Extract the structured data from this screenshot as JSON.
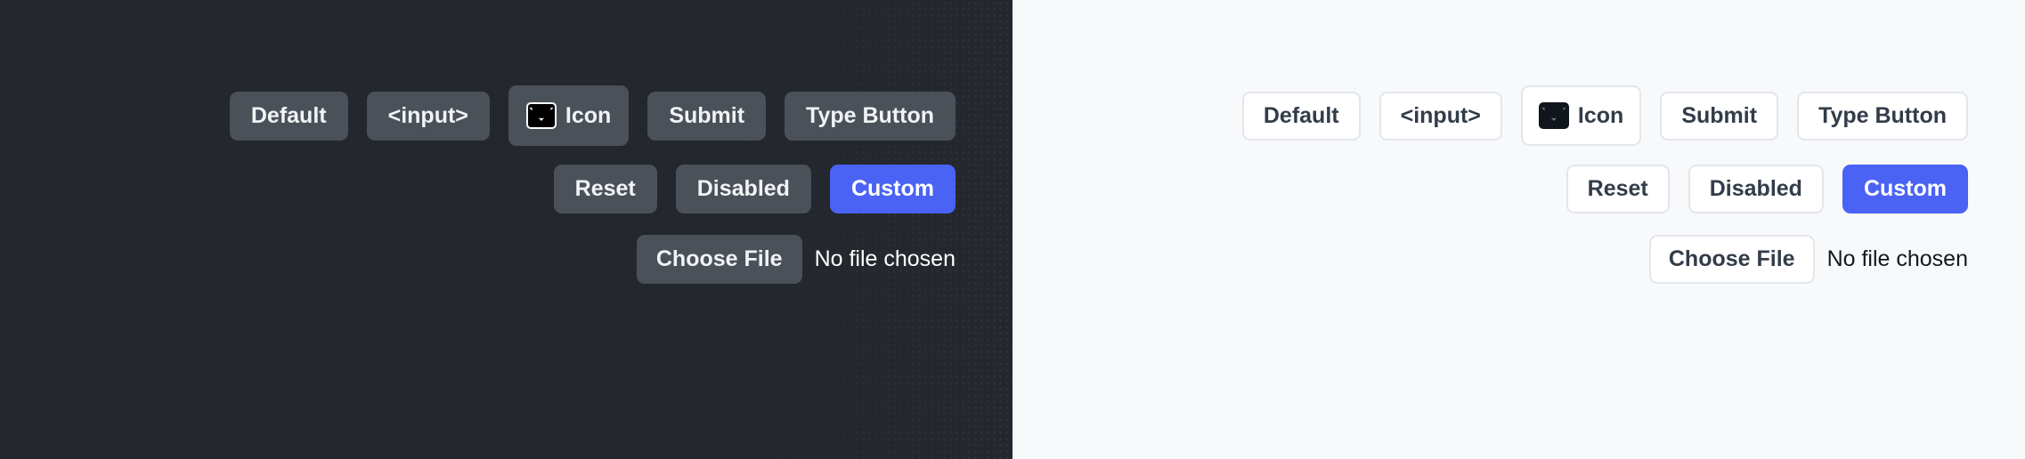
{
  "panels": [
    {
      "theme": "dark",
      "background": "#24272d",
      "button_bg": "#4a5159",
      "text_color": "#f1f3f5",
      "accent": "#4a63f5",
      "rows": {
        "primary": [
          {
            "label": "Default",
            "name": "default-button"
          },
          {
            "label": "<input>",
            "name": "input-button"
          },
          {
            "label": "Icon",
            "name": "icon-button",
            "icon": "envelope-icon"
          },
          {
            "label": "Submit",
            "name": "submit-button"
          },
          {
            "label": "Type Button",
            "name": "type-button"
          }
        ],
        "secondary": [
          {
            "label": "Reset",
            "name": "reset-button"
          },
          {
            "label": "Disabled",
            "name": "disabled-button"
          },
          {
            "label": "Custom",
            "name": "custom-button"
          }
        ],
        "file": {
          "button_label": "Choose File",
          "status_text": "No file chosen"
        }
      }
    },
    {
      "theme": "light",
      "background": "#f8f9fb",
      "button_bg": "#ffffff",
      "border_color": "#e3e6eb",
      "text_color": "#333c49",
      "accent": "#4a63f5",
      "rows": {
        "primary": [
          {
            "label": "Default",
            "name": "default-button"
          },
          {
            "label": "<input>",
            "name": "input-button"
          },
          {
            "label": "Icon",
            "name": "icon-button",
            "icon": "envelope-icon"
          },
          {
            "label": "Submit",
            "name": "submit-button"
          },
          {
            "label": "Type Button",
            "name": "type-button"
          }
        ],
        "secondary": [
          {
            "label": "Reset",
            "name": "reset-button"
          },
          {
            "label": "Disabled",
            "name": "disabled-button"
          },
          {
            "label": "Custom",
            "name": "custom-button"
          }
        ],
        "file": {
          "button_label": "Choose File",
          "status_text": "No file chosen"
        }
      }
    }
  ]
}
